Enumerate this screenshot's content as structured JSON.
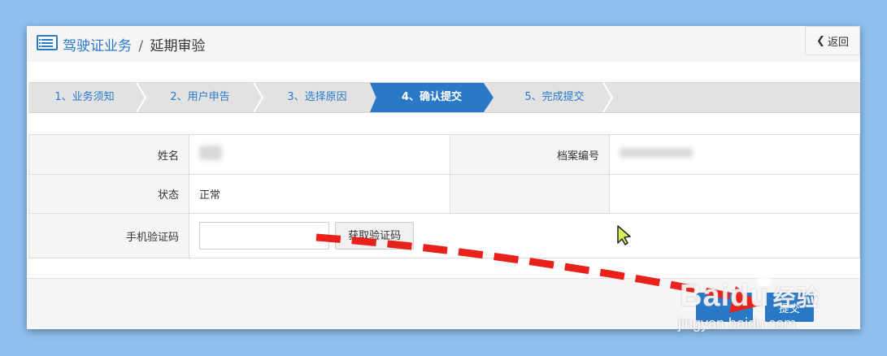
{
  "header": {
    "biz": "驾驶证业务",
    "sep": "/",
    "sub": "延期审验",
    "back": "返回",
    "back_icon": "chevron-left-icon",
    "title_icon": "list-icon"
  },
  "steps": [
    {
      "label": "1、业务须知",
      "active": false
    },
    {
      "label": "2、用户申告",
      "active": false
    },
    {
      "label": "3、选择原因",
      "active": false
    },
    {
      "label": "4、确认提交",
      "active": true
    },
    {
      "label": "5、完成提交",
      "active": false
    }
  ],
  "form": {
    "name_label": "姓名",
    "file_label": "档案编号",
    "status_label": "状态",
    "status_value": "正常",
    "phone_label": "手机验证码",
    "get_code": "获取验证码"
  },
  "footer": {
    "submit_label": "提交"
  },
  "watermark": {
    "logo": "Baidu",
    "logo_cn": "经验",
    "url": "jingyan.baidu.com"
  },
  "colors": {
    "accent": "#2a79c9",
    "background": "#8fc1f0",
    "arrow": "#e8211a",
    "cursor": "#d7f05a"
  }
}
